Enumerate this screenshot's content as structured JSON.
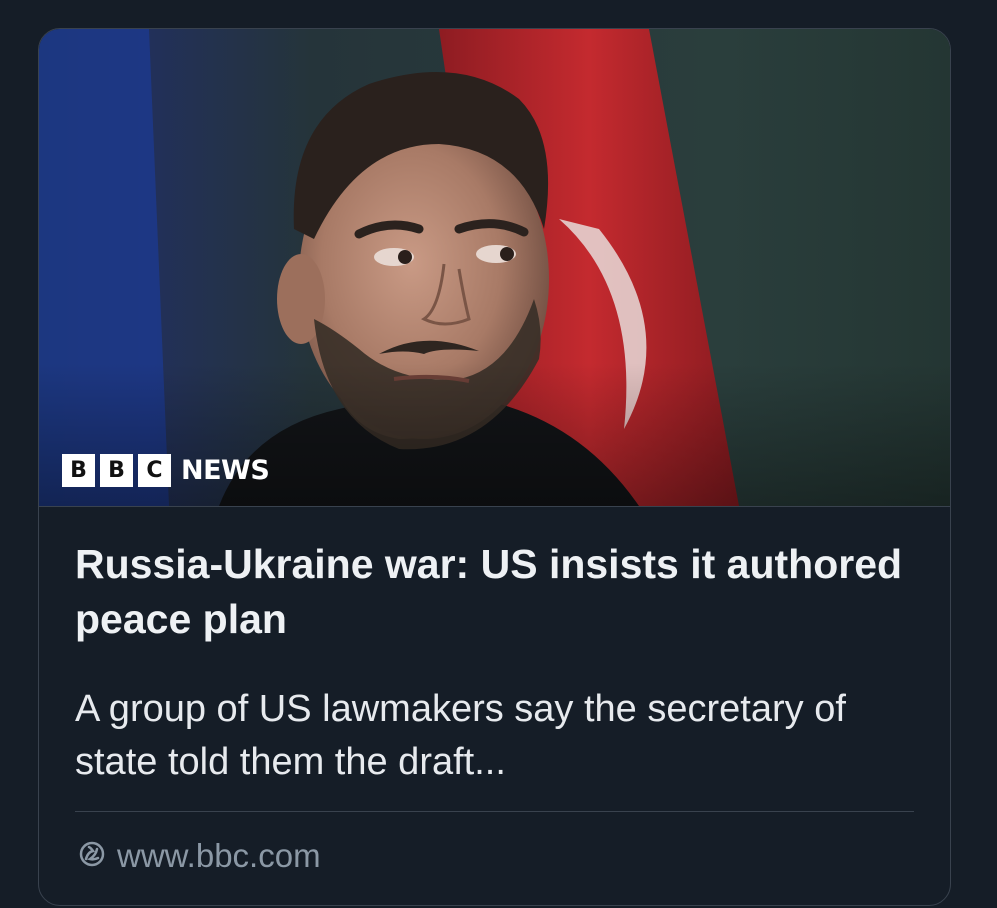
{
  "card": {
    "image": {
      "alt": "Photo of a bearded man in dark clothing against a flag background",
      "badge": {
        "letters": [
          "B",
          "B",
          "C"
        ],
        "word": "NEWS"
      }
    },
    "headline": "Russia-Ukraine war: US insists it authored peace plan",
    "description": "A group of US lawmakers say the secretary of state told them the draft...",
    "link": {
      "icon": "link-globe-icon",
      "domain": "www.bbc.com"
    }
  },
  "colors": {
    "background": "#151d27",
    "border": "#39424e",
    "headline": "#eef1f4",
    "description": "#e7eaee",
    "muted": "#8b98a5",
    "flag_red": "#b8262a",
    "flag_blue": "#1d3a8f"
  }
}
